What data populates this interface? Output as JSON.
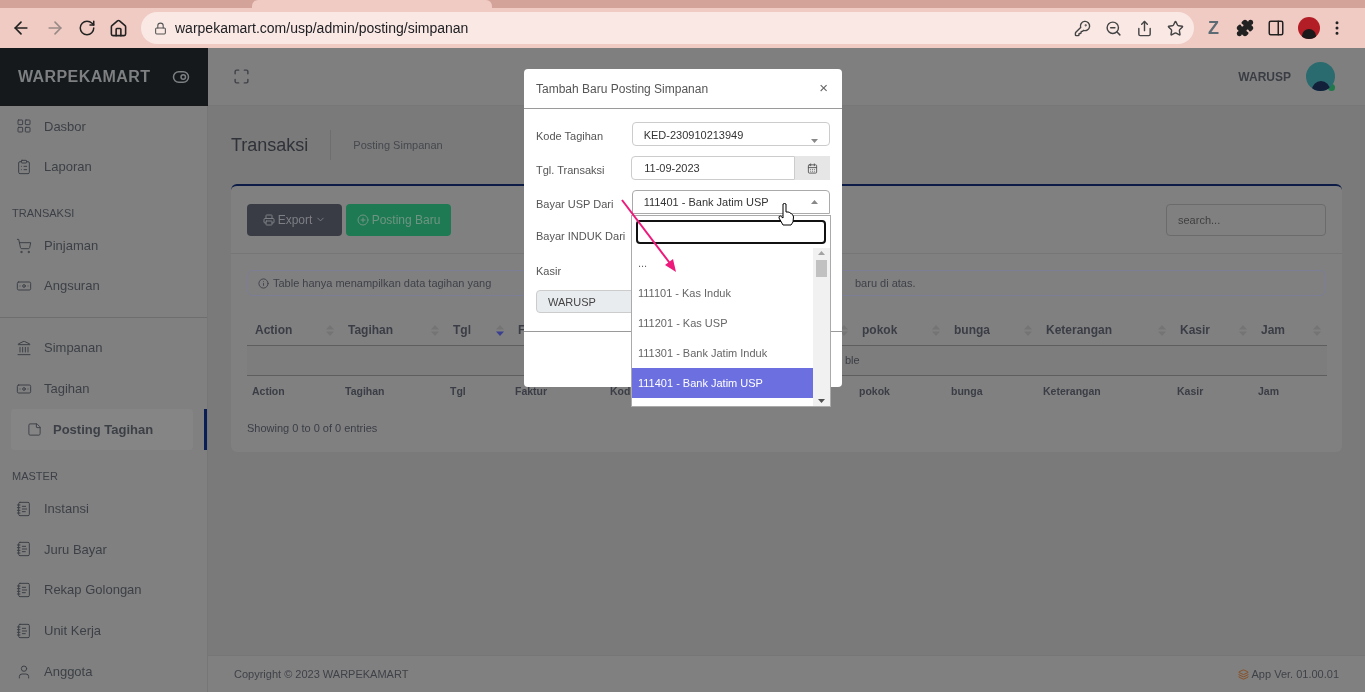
{
  "browser": {
    "url": "warpekamart.com/usp/admin/posting/simpanan",
    "forward_disabled": true,
    "extension_label": "Z"
  },
  "sidebar": {
    "brand": "WARPEKAMART",
    "items": [
      {
        "kind": "link",
        "label": "Dasbor",
        "selected": false
      },
      {
        "kind": "link",
        "label": "Laporan",
        "selected": false
      },
      {
        "kind": "heading",
        "label": "TRANSAKSI"
      },
      {
        "kind": "link",
        "label": "Pinjaman",
        "selected": false
      },
      {
        "kind": "link",
        "label": "Angsuran",
        "selected": false
      },
      {
        "kind": "divider"
      },
      {
        "kind": "link",
        "label": "Simpanan",
        "selected": false
      },
      {
        "kind": "link",
        "label": "Tagihan",
        "selected": false,
        "children": [
          {
            "label": "Posting Tagihan",
            "selected": true
          }
        ]
      },
      {
        "kind": "heading",
        "label": "MASTER"
      },
      {
        "kind": "link",
        "label": "Instansi",
        "selected": false
      },
      {
        "kind": "link",
        "label": "Juru Bayar",
        "selected": false
      },
      {
        "kind": "link",
        "label": "Rekap Golongan",
        "selected": false
      },
      {
        "kind": "link",
        "label": "Unit Kerja",
        "selected": false
      },
      {
        "kind": "link",
        "label": "Anggota",
        "selected": false
      }
    ]
  },
  "topbar": {
    "user": "WARUSP",
    "online": true
  },
  "page": {
    "title": "Transaksi",
    "breadcrumb": "Posting Simpanan"
  },
  "toolbar": {
    "export": "Export",
    "new": "Posting Baru",
    "search_placeholder": "search..."
  },
  "alert": {
    "text_start": "Table hanya menampilkan data tagihan yang",
    "text_end": "baru di atas."
  },
  "table": {
    "header": [
      {
        "label": "Action",
        "sorted": false
      },
      {
        "label": "Tagihan",
        "sorted": false
      },
      {
        "label": "Tgl",
        "sorted": true
      },
      {
        "label": "F"
      },
      {
        "sorted": false
      },
      {
        "label": "pokok",
        "sorted": false
      },
      {
        "label": "bunga",
        "sorted": false
      },
      {
        "label": "Keterangan",
        "sorted": false
      },
      {
        "label": "Kasir",
        "sorted": false
      },
      {
        "label": "Jam",
        "sorted": false
      }
    ],
    "empty_text": "ble",
    "footer": [
      "Action",
      "Tagihan",
      "Tgl",
      "Faktur",
      "Kod",
      "pokok",
      "bunga",
      "Keterangan",
      "Kasir",
      "Jam"
    ],
    "info": "Showing 0 to 0 of 0 entries"
  },
  "modal": {
    "title": "Tambah Baru Posting Simpanan",
    "close": "×",
    "fields": [
      {
        "kind": "select",
        "label": "Kode Tagihan",
        "value": "KED-230910213949",
        "expanded": false
      },
      {
        "kind": "date",
        "label": "Tgl. Transaksi",
        "value": "11-09-2023"
      },
      {
        "kind": "select",
        "label": "Bayar USP Dari",
        "value": "111401 - Bank Jatim USP",
        "expanded": true
      },
      {
        "kind": "label",
        "label": "Bayar INDUK Dari"
      },
      {
        "kind": "readonly",
        "label": "Kasir",
        "value": "WARUSP"
      }
    ]
  },
  "dropdown": {
    "options": [
      {
        "label": "...",
        "selected": false
      },
      {
        "label": "111101 - Kas Induk",
        "selected": false
      },
      {
        "label": "111201 - Kas USP",
        "selected": false
      },
      {
        "label": "111301 - Bank Jatim Induk",
        "selected": false
      },
      {
        "label": "111401 - Bank Jatim USP",
        "selected": true
      }
    ]
  },
  "footer": {
    "copyright": "Copyright © 2023 WARPEKAMART",
    "version": "App Ver. 01.00.01"
  }
}
